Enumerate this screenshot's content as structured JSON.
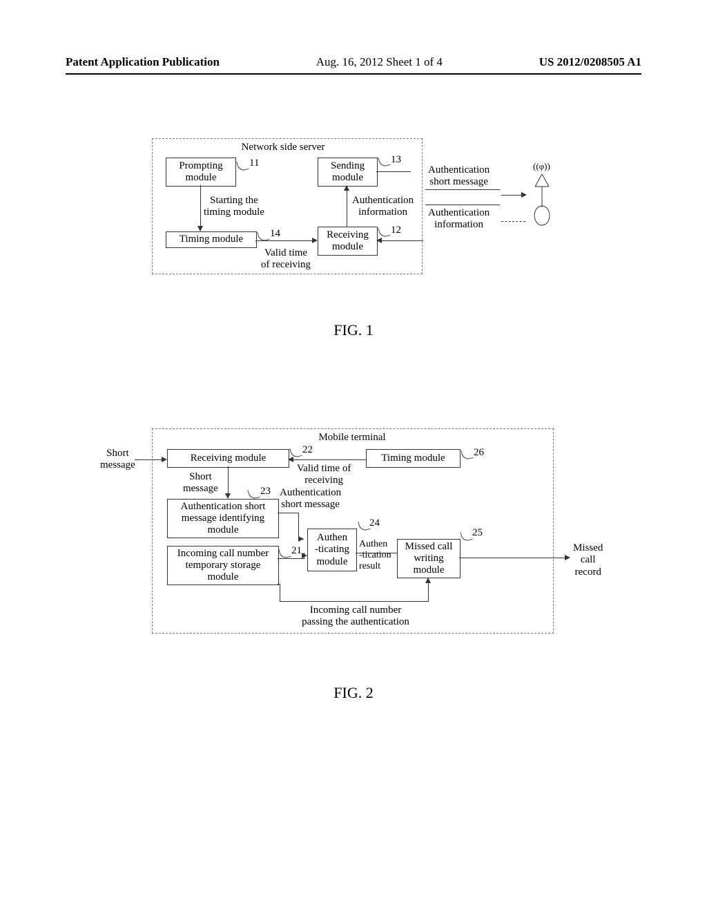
{
  "header": {
    "left": "Patent Application Publication",
    "mid": "Aug. 16, 2012  Sheet 1 of 4",
    "right": "US 2012/0208505 A1"
  },
  "fig1": {
    "title": "FIG. 1",
    "frame_title": "Network side server",
    "boxes": {
      "prompting": "Prompting\nmodule",
      "sending": "Sending\nmodule",
      "timing": "Timing module",
      "receiving": "Receiving\nmodule"
    },
    "refs": {
      "r11": "11",
      "r12": "12",
      "r13": "13",
      "r14": "14"
    },
    "labels": {
      "starting": "Starting the\ntiming module",
      "valid": "Valid time\nof receiving",
      "auth_info_inner": "Authentication\ninformation",
      "auth_sms": "Authentication\nshort message",
      "auth_info_outer": "Authentication\ninformation",
      "antenna_waves": "((φ))"
    }
  },
  "fig2": {
    "title": "FIG. 2",
    "frame_title": "Mobile terminal",
    "boxes": {
      "receiving": "Receiving module",
      "timing": "Timing module",
      "auth_id": "Authentication short\nmessage identifying\nmodule",
      "incoming": "Incoming call number\ntemporary storage\nmodule",
      "authenticating": "Authen\n-ticating\nmodule",
      "missed_write": "Missed call\nwriting\nmodule"
    },
    "refs": {
      "r21": "21",
      "r22": "22",
      "r23": "23",
      "r24": "24",
      "r25": "25",
      "r26": "26"
    },
    "labels": {
      "short_msg_in": "Short\nmessage",
      "valid": "Valid time of\nreceiving",
      "short_msg_mid": "Short\nmessage",
      "auth_sms": "Authentication\nshort message",
      "auth_result": "Authen\n-tication\nresult",
      "passing": "Incoming call number\npassing the authentication",
      "missed_out": "Missed\ncall\nrecord"
    }
  }
}
